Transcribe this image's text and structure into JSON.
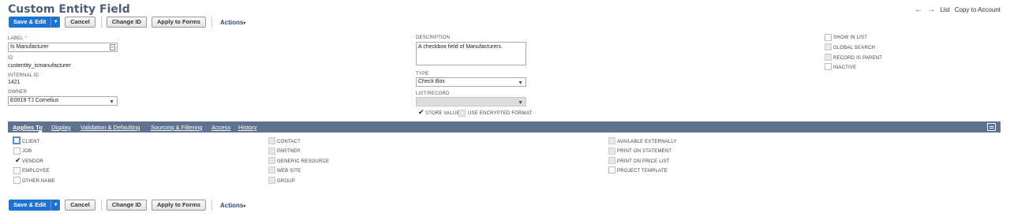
{
  "page": {
    "title": "Custom Entity Field"
  },
  "topnav": {
    "back": "←",
    "forward": "→",
    "list": "List",
    "copy_to_account": "Copy to Account"
  },
  "toolbar": {
    "save_edit": "Save & Edit",
    "dropdown_caret": "▼",
    "cancel": "Cancel",
    "change_id": "Change ID",
    "apply_to_forms": "Apply to Forms",
    "actions": "Actions",
    "actions_caret": "▾"
  },
  "fields": {
    "label": {
      "label": "LABEL",
      "required_mark": "*",
      "value": "Is Manufacturer",
      "icon": "≡"
    },
    "id": {
      "label": "ID",
      "value": "custentity_ismanufacturer"
    },
    "internal_id": {
      "label": "INTERNAL ID",
      "value": "1421"
    },
    "owner": {
      "label": "OWNER",
      "value": "E0019 TJ Cornelius"
    },
    "description": {
      "label": "DESCRIPTION",
      "value": "A checkbox field of Manufacturers."
    },
    "type": {
      "label": "TYPE",
      "value": "Check Box"
    },
    "list_record": {
      "label": "LIST/RECORD",
      "value": ""
    },
    "store_value": {
      "label": "STORE VALUE",
      "checked": true
    },
    "use_encrypted_format": {
      "label": "USE ENCRYPTED FORMAT",
      "checked": false
    }
  },
  "right_options": [
    {
      "label": "SHOW IN LIST",
      "checked": false
    },
    {
      "label": "GLOBAL SEARCH",
      "checked": false
    },
    {
      "label": "RECORD IS PARENT",
      "checked": false
    },
    {
      "label": "INACTIVE",
      "checked": false
    }
  ],
  "tabs": [
    {
      "label": "Applies To",
      "active": true
    },
    {
      "label": "Display",
      "active": false
    },
    {
      "label": "Validation & Defaulting",
      "active": false
    },
    {
      "label": "Sourcing & Filtering",
      "active": false
    },
    {
      "label": "Access",
      "active": false
    },
    {
      "label": "History",
      "active": false
    }
  ],
  "applies_to": {
    "col1": [
      {
        "label": "CLIENT",
        "checked": false
      },
      {
        "label": "JOB",
        "checked": false
      },
      {
        "label": "VENDOR",
        "checked": true
      },
      {
        "label": "EMPLOYEE",
        "checked": false
      },
      {
        "label": "OTHER NAME",
        "checked": false
      }
    ],
    "col2": [
      {
        "label": "CONTACT",
        "checked": false
      },
      {
        "label": "PARTNER",
        "checked": false
      },
      {
        "label": "GENERIC RESOURCE",
        "checked": false
      },
      {
        "label": "WEB SITE",
        "checked": false
      },
      {
        "label": "GROUP",
        "checked": false
      }
    ],
    "col3": [
      {
        "label": "AVAILABLE EXTERNALLY",
        "checked": false
      },
      {
        "label": "PRINT ON STATEMENT",
        "checked": false
      },
      {
        "label": "PRINT ON PRICE LIST",
        "checked": false
      },
      {
        "label": "PROJECT TEMPLATE",
        "checked": false
      }
    ]
  },
  "check_glyph": "✔"
}
